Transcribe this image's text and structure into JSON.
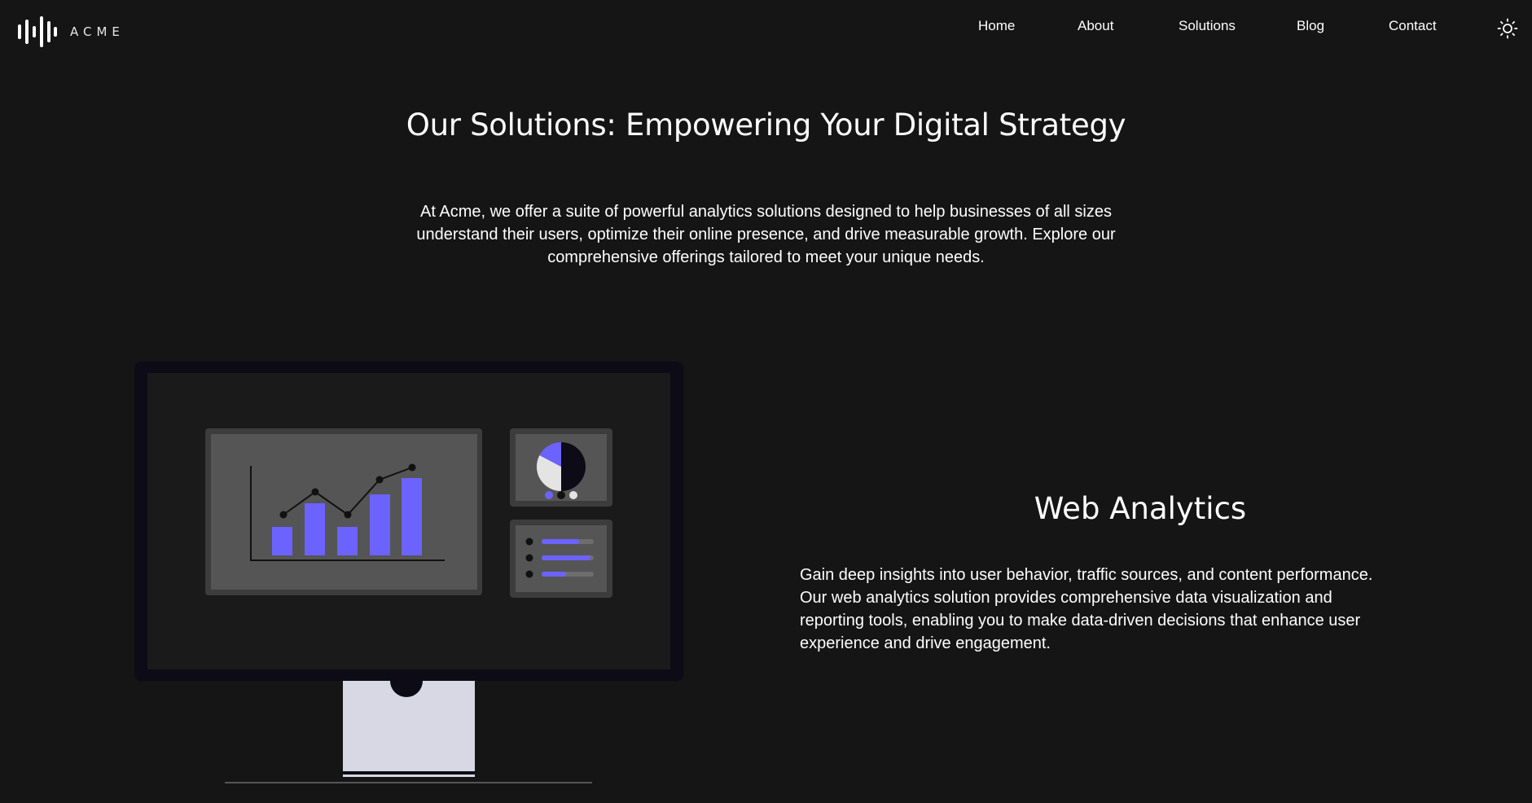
{
  "header": {
    "logo_text": "ACME",
    "nav": [
      {
        "label": "Home"
      },
      {
        "label": "About"
      },
      {
        "label": "Solutions"
      },
      {
        "label": "Blog"
      },
      {
        "label": "Contact"
      }
    ],
    "theme_icon": "sun-icon"
  },
  "hero": {
    "title": "Our Solutions: Empowering Your Digital Strategy",
    "intro": "At Acme, we offer a suite of powerful analytics solutions designed to help businesses of all sizes understand their users, optimize their online presence, and drive measurable growth. Explore our comprehensive offerings tailored to meet your unique needs."
  },
  "solution": {
    "title": "Web Analytics",
    "description": "Gain deep insights into user behavior, traffic sources, and content performance. Our web analytics solution provides comprehensive data visualization and reporting tools, enabling you to make data-driven decisions that enhance user experience and drive engagement.",
    "illustration_icon": "analytics-dashboard-monitor-illustration"
  },
  "colors": {
    "background": "#151515",
    "accent": "#6c63ff",
    "monitor_frame": "#0c0b16",
    "panel": "#545454",
    "stand": "#d8d8e4"
  }
}
